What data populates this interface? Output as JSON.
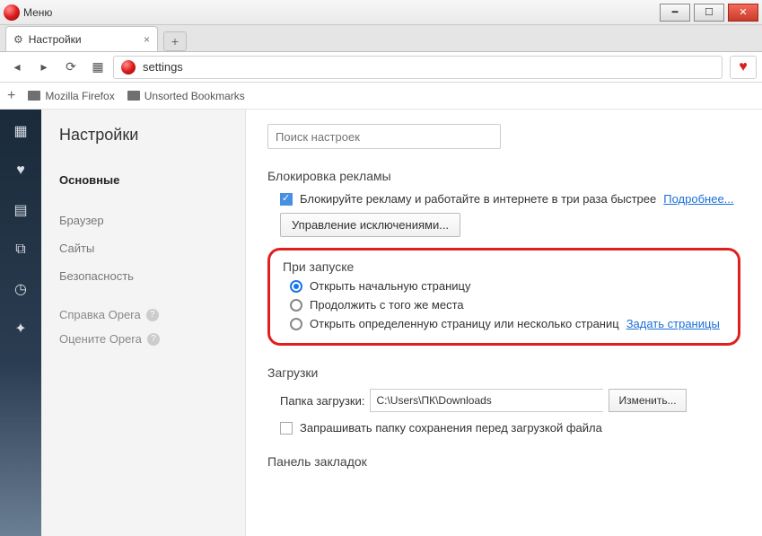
{
  "window": {
    "menu": "Меню"
  },
  "tab": {
    "title": "Настройки"
  },
  "addressbar": {
    "value": "settings"
  },
  "bookmarks_bar": {
    "f1": "Mozilla Firefox",
    "f2": "Unsorted Bookmarks"
  },
  "sidebar": {
    "heading": "Настройки",
    "cats": {
      "basic": "Основные",
      "browser": "Браузер",
      "sites": "Сайты",
      "security": "Безопасность"
    },
    "help": "Справка Opera",
    "rate": "Оцените Opera"
  },
  "content": {
    "search_placeholder": "Поиск настроек",
    "adblock": {
      "title": "Блокировка рекламы",
      "text": "Блокируйте рекламу и работайте в интернете в три раза быстрее",
      "more": "Подробнее...",
      "manage": "Управление исключениями..."
    },
    "startup": {
      "title": "При запуске",
      "opt1": "Открыть начальную страницу",
      "opt2": "Продолжить с того же места",
      "opt3": "Открыть определенную страницу или несколько страниц",
      "set_pages": "Задать страницы"
    },
    "downloads": {
      "title": "Загрузки",
      "label": "Папка загрузки:",
      "path": "C:\\Users\\ПК\\Downloads",
      "change": "Изменить...",
      "ask": "Запрашивать папку сохранения перед загрузкой файла"
    },
    "bookmarks_panel": {
      "title": "Панель закладок"
    }
  }
}
